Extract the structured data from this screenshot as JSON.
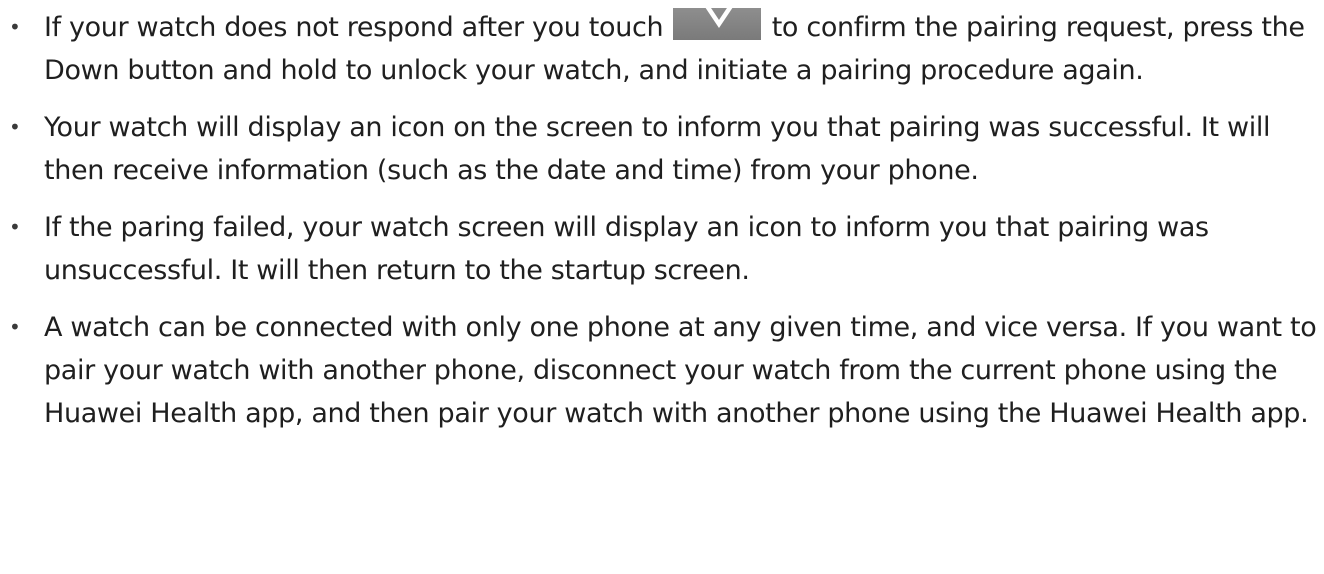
{
  "bullets": [
    {
      "text_before_icon": "If your watch does not respond after you touch",
      "icon": "confirm-check-icon",
      "text_after_icon": "to confirm the pairing request, press the Down button and hold to unlock your watch, and initiate a pairing procedure again."
    },
    {
      "text": "Your watch will display an icon on the screen to inform you that pairing was successful. It will then receive information (such as the date and time) from your phone."
    },
    {
      "text": "If the paring failed, your watch screen will display an icon to inform you that pairing was unsuccessful. It will then return to the startup screen."
    },
    {
      "text": "A watch can be connected with only one phone at any given time, and vice versa. If you want to pair your watch with another phone, disconnect your watch from the current phone using the Huawei Health app, and then pair your watch with another phone using the Huawei Health app."
    }
  ],
  "bullet_glyph": "•",
  "colors": {
    "text": "#1f1f1f",
    "icon_background": "#858585",
    "icon_check": "#ffffff"
  }
}
